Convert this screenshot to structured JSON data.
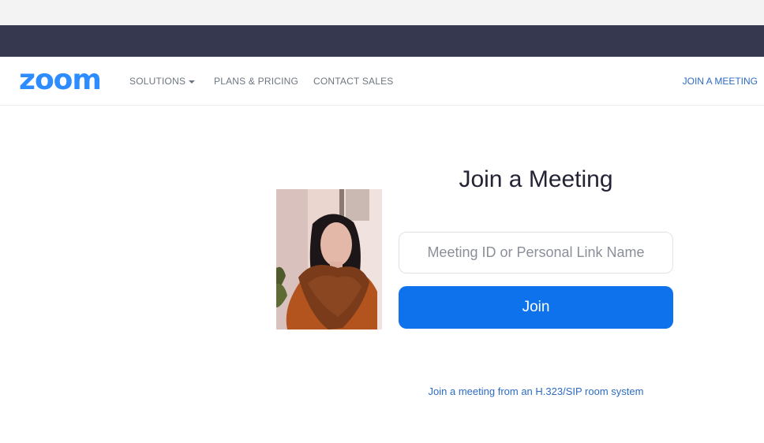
{
  "navbar": {
    "logo": "zoom",
    "items": [
      {
        "label": "SOLUTIONS"
      },
      {
        "label": "PLANS & PRICING"
      },
      {
        "label": "CONTACT SALES"
      }
    ],
    "join_link": "JOIN A MEETING"
  },
  "main": {
    "title": "Join a Meeting",
    "input_placeholder": "Meeting ID or Personal Link Name",
    "join_button": "Join",
    "sip_link": "Join a meeting from an H.323/SIP room system"
  },
  "colors": {
    "brand": "#2d8cff",
    "button": "#0e72ed",
    "header_bar": "#363850",
    "link": "#2d6bc4"
  }
}
